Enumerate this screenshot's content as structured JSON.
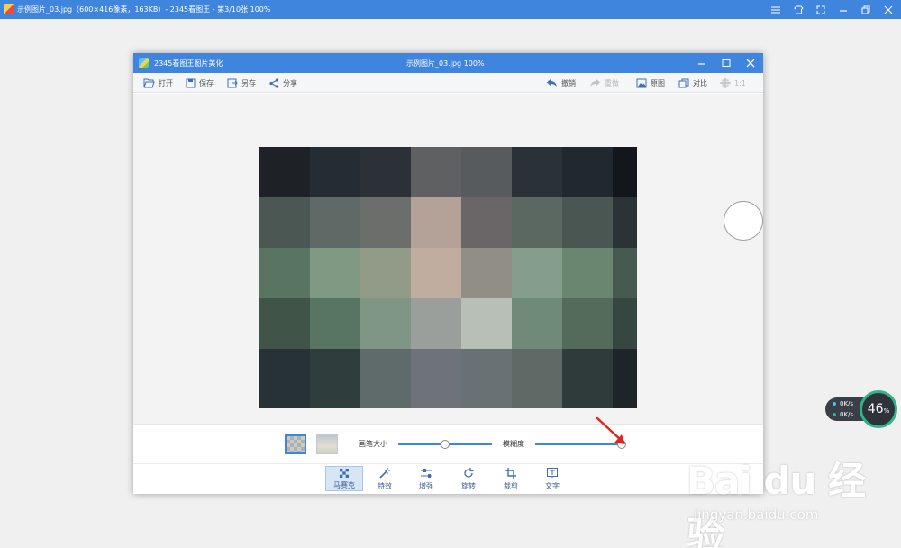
{
  "outer_window": {
    "title": "示例图片_03.jpg（600×416像素，163KB）- 2345看图王 - 第3/10张 100%",
    "controls": [
      "menu-icon",
      "skin-icon",
      "fullscreen-icon",
      "minimize-icon",
      "restore-icon",
      "close-icon"
    ]
  },
  "editor_window": {
    "app_name": "2345看图王图片美化",
    "file_title": "示例图片_03.jpg  100%"
  },
  "toolbar": {
    "open": "打开",
    "save": "保存",
    "save_as": "另存",
    "share": "分享",
    "undo": "撤销",
    "redo": "重做",
    "original": "原图",
    "compare": "对比",
    "actual_size": "1:1"
  },
  "mosaic_panel": {
    "brush_size_label": "画笔大小",
    "blur_label": "模糊度",
    "brush_size_level": 0.5,
    "blur_level": 1.0
  },
  "tools": [
    {
      "label": "马赛克",
      "icon": "mosaic-icon",
      "active": true
    },
    {
      "label": "特效",
      "icon": "magic-wand-icon",
      "active": false
    },
    {
      "label": "增强",
      "icon": "sliders-icon",
      "active": false
    },
    {
      "label": "旋转",
      "icon": "rotate-icon",
      "active": false
    },
    {
      "label": "裁剪",
      "icon": "crop-icon",
      "active": false
    },
    {
      "label": "文字",
      "icon": "text-icon",
      "active": false
    }
  ],
  "mosaic_colors": [
    [
      "#1e2227",
      "#252c33",
      "#2c3137",
      "#5e6061",
      "#575b5e",
      "#2a3138",
      "#222830",
      "#13161b"
    ],
    [
      "#4b5752",
      "#5f6a66",
      "#6b6e6a",
      "#b4a197",
      "#6a6567",
      "#5a6861",
      "#4a5651",
      "#2b3336"
    ],
    [
      "#5a7462",
      "#7f9982",
      "#919b87",
      "#c0ad9f",
      "#918f85",
      "#859e8b",
      "#6a8670",
      "#465a52"
    ],
    [
      "#405548",
      "#587462",
      "#7f9684",
      "#9a9f9b",
      "#b7bfb6",
      "#6f8a77",
      "#546b5b",
      "#364640"
    ],
    [
      "#263235",
      "#2f3e3c",
      "#5f6b6b",
      "#6d7378",
      "#687275",
      "#5f6a67",
      "#2e3b3a",
      "#1d2529"
    ],
    [
      "#263235",
      "#2f3e3c",
      "#5f6b6b",
      "#6d7378",
      "#687275",
      "#5f6a67",
      "#2e3b3a",
      "#1d2529"
    ]
  ],
  "net_speed": {
    "upload": "0K/s",
    "download": "0K/s",
    "percent": "46",
    "percent_unit": "%"
  },
  "watermark": {
    "logo": "Bai du 经验",
    "url": "jingyan.baidu.com"
  },
  "colors": {
    "accent": "#3f85de",
    "ring": "#2fb38a"
  }
}
